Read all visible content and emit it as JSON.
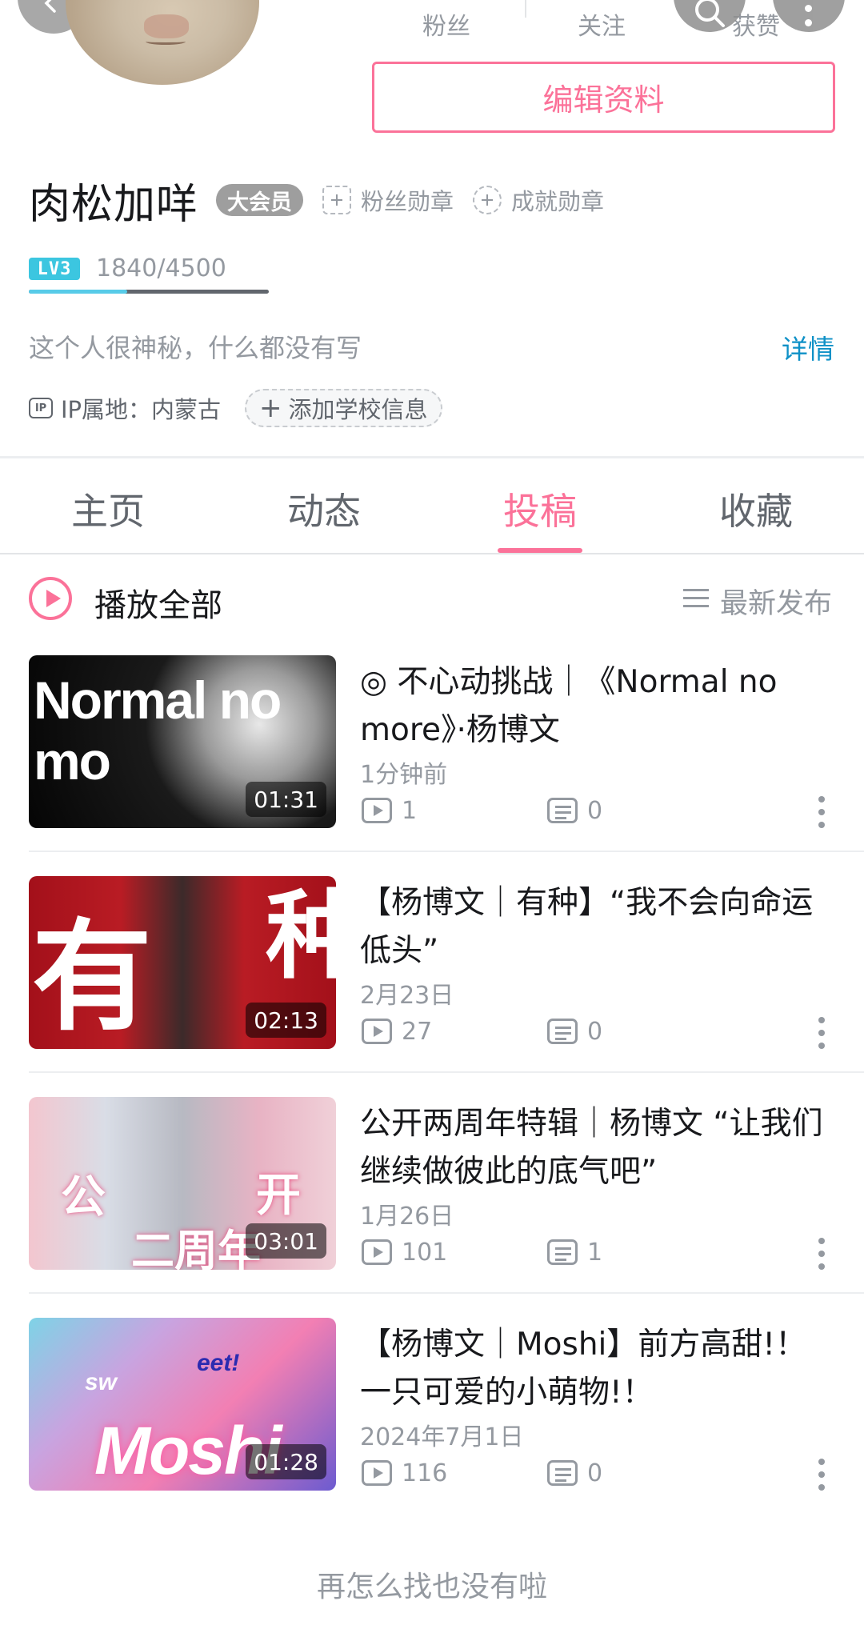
{
  "header": {
    "stats": [
      {
        "label": "粉丝"
      },
      {
        "label": "关注"
      },
      {
        "label": "获赞"
      }
    ],
    "edit_profile_label": "编辑资料",
    "user_name": "肉松加咩",
    "vip_label": "大会员",
    "fan_medal_label": "粉丝勋章",
    "achievement_medal_label": "成就勋章",
    "level_label": "LV3",
    "exp_text": "1840/4500",
    "exp_progress": 0.4089,
    "bio": "这个人很神秘，什么都没有写",
    "detail_link": "详情",
    "ip_icon_text": "IP",
    "ip_location": "IP属地：内蒙古",
    "add_school_label": "添加学校信息",
    "colors": {
      "accent": "#fb7299",
      "link": "#0f91c7",
      "level": "#3cc6e0"
    }
  },
  "tabs": [
    {
      "label": "主页",
      "active": false
    },
    {
      "label": "动态",
      "active": false
    },
    {
      "label": "投稿",
      "active": true
    },
    {
      "label": "收藏",
      "active": false
    }
  ],
  "play_bar": {
    "play_all_label": "播放全部",
    "sort_label": "最新发布"
  },
  "videos": [
    {
      "title": "◎ 不心动挑战｜《Normal no more》·杨博文",
      "date": "1分钟前",
      "duration": "01:31",
      "plays": "1",
      "comments": "0",
      "thumb_text": "Normal no mo"
    },
    {
      "title": "【杨博文｜有种】“我不会向命运低头”",
      "date": "2月23日",
      "duration": "02:13",
      "plays": "27",
      "comments": "0",
      "thumb_text_left": "有",
      "thumb_text_right": "种"
    },
    {
      "title": "公开两周年特辑｜杨博文 “让我们继续做彼此的底气吧”",
      "date": "1月26日",
      "duration": "03:01",
      "plays": "101",
      "comments": "1",
      "thumb_text_left": "公",
      "thumb_text_right": "开",
      "thumb_text_bottom": "二周年"
    },
    {
      "title": "【杨博文｜Moshi】前方高甜!！一只可爱的小萌物!！",
      "date": "2024年7月1日",
      "duration": "01:28",
      "plays": "116",
      "comments": "0",
      "thumb_text_main": "Moshi",
      "thumb_text_small": "sw",
      "thumb_text_badge": "eet!"
    }
  ],
  "footer": {
    "end_text": "再怎么找也没有啦"
  }
}
